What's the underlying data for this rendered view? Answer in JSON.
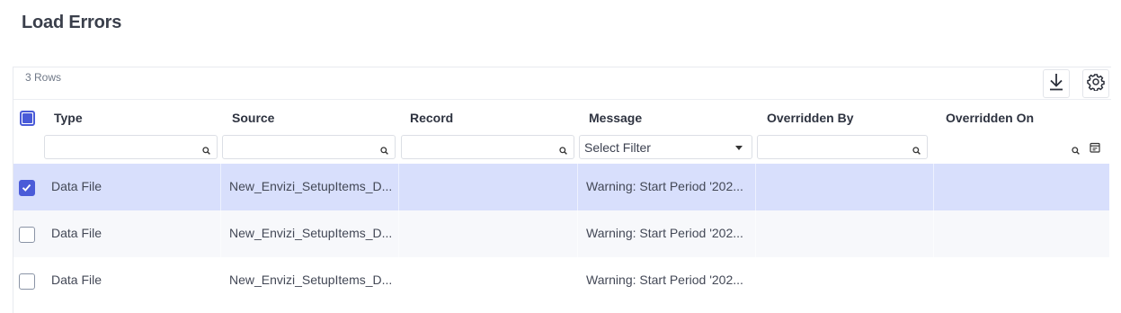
{
  "page": {
    "title": "Load Errors"
  },
  "grid": {
    "row_count": "3 Rows",
    "columns": [
      {
        "key": "type",
        "label": "Type"
      },
      {
        "key": "source",
        "label": "Source"
      },
      {
        "key": "record",
        "label": "Record"
      },
      {
        "key": "message",
        "label": "Message"
      },
      {
        "key": "overridden_by",
        "label": "Overridden By"
      },
      {
        "key": "overridden_on",
        "label": "Overridden On"
      }
    ],
    "filters": {
      "type": "",
      "source": "",
      "record": "",
      "message_select": "Select Filter",
      "overridden_by": "",
      "overridden_on": ""
    },
    "rows": [
      {
        "selected": true,
        "type": "Data File",
        "source": "New_Envizi_SetupItems_D...",
        "record": "",
        "message": "Warning: Start Period '202...",
        "overridden_by": "",
        "overridden_on": ""
      },
      {
        "selected": false,
        "type": "Data File",
        "source": "New_Envizi_SetupItems_D...",
        "record": "",
        "message": "Warning: Start Period '202...",
        "overridden_by": "",
        "overridden_on": ""
      },
      {
        "selected": false,
        "type": "Data File",
        "source": "New_Envizi_SetupItems_D...",
        "record": "",
        "message": "Warning: Start Period '202...",
        "overridden_by": "",
        "overridden_on": ""
      }
    ]
  },
  "toolbar": {
    "download_icon": "download-icon",
    "settings_icon": "gear-icon"
  },
  "colors": {
    "accent": "#4a5bd8",
    "selected_row": "#d8dffc",
    "alt_row": "#f7f8fb"
  }
}
